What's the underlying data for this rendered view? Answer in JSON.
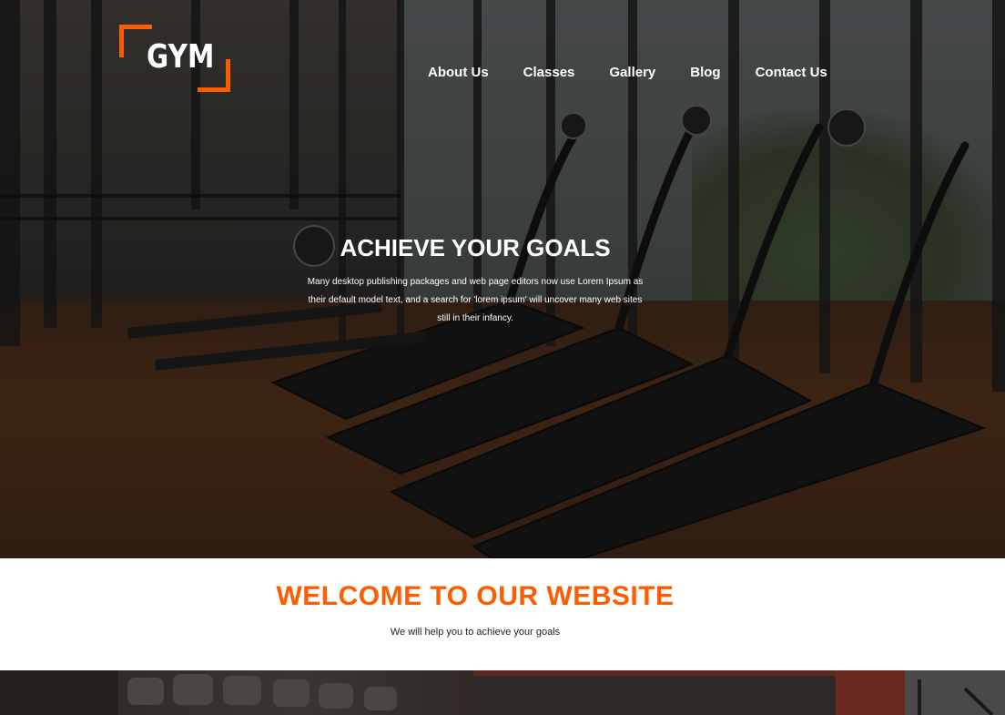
{
  "brand": {
    "logo_text": "GYM",
    "accent_color": "#ff5c00"
  },
  "nav": {
    "items": [
      {
        "label": "About Us"
      },
      {
        "label": "Classes"
      },
      {
        "label": "Gallery"
      },
      {
        "label": "Blog"
      },
      {
        "label": "Contact Us"
      }
    ]
  },
  "hero": {
    "title": "ACHIEVE YOUR GOALS",
    "text_lines": [
      "Many desktop publishing packages and web page editors now use Lorem Ipsum as",
      "their default model text, and a search for 'lorem ipsum' will uncover many web sites",
      "still in their infancy."
    ],
    "background_image": "gym-treadmills-photo"
  },
  "welcome": {
    "title": "WELCOME TO OUR WEBSITE",
    "subtitle": "We will help you to achieve your goals"
  },
  "strip": {
    "background_image": "gym-dumbbells-photo"
  }
}
